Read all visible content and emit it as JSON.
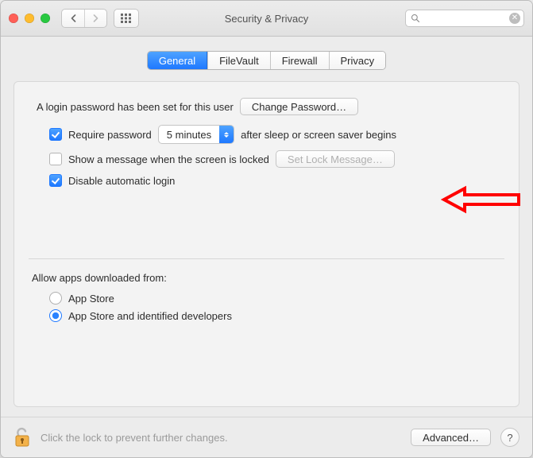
{
  "window": {
    "title": "Security & Privacy"
  },
  "search": {
    "placeholder": ""
  },
  "tabs": [
    {
      "label": "General",
      "active": true
    },
    {
      "label": "FileVault",
      "active": false
    },
    {
      "label": "Firewall",
      "active": false
    },
    {
      "label": "Privacy",
      "active": false
    }
  ],
  "general": {
    "password_set_text": "A login password has been set for this user",
    "change_password_btn": "Change Password…",
    "require_password": {
      "checked": true,
      "label_before": "Require password",
      "delay_value": "5 minutes",
      "label_after": "after sleep or screen saver begins"
    },
    "show_message": {
      "checked": false,
      "label": "Show a message when the screen is locked",
      "button": "Set Lock Message…",
      "button_enabled": false
    },
    "disable_auto_login": {
      "checked": true,
      "label": "Disable automatic login"
    },
    "allow_apps": {
      "heading": "Allow apps downloaded from:",
      "options": [
        {
          "label": "App Store",
          "selected": false
        },
        {
          "label": "App Store and identified developers",
          "selected": true
        }
      ]
    }
  },
  "footer": {
    "lock_text": "Click the lock to prevent further changes.",
    "advanced_btn": "Advanced…",
    "help": "?"
  }
}
